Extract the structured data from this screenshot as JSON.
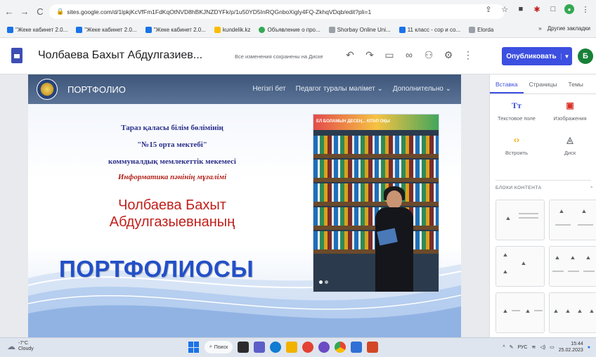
{
  "browser": {
    "url": "sites.google.com/d/1lpkjKcVfFm1FdKqOtNVD8hBKJNZDYFk/p/1u50YD5InRQGnboXigly4FQ-ZkhqVDqb/edit?pli=1",
    "bookmarks": [
      "\"Жеке кабинет 2.0...",
      "\"Жеке кабинет 2.0...",
      "\"Жеке кабинет 2.0...",
      "kundelik.kz",
      "Объявление о про...",
      "Shorbay Online Uni...",
      "11 класс - сор и со...",
      "Elorda"
    ],
    "other_bookmarks": "Другие закладки"
  },
  "editor": {
    "doc_title": "Чолбаева Бахыт Абдулгазиев...",
    "save_status": "Все изменения сохранены на Диске",
    "publish_label": "Опубликовать",
    "avatar_letter": "Б"
  },
  "site": {
    "name": "ПОРТФОЛИО",
    "menu": [
      "Негізгі бет",
      "Педагог туралы мәлімет",
      "Дополнительно"
    ],
    "school_line1": "Тараз қаласы білім бөлімінің",
    "school_line2": "\"№15 орта мектебі\"",
    "school_line3": "коммуналдық мемлекеттік мекемесі",
    "school_line4": "Информатика пәнінің мұғалімі",
    "teacher_line1": "Чолбаева Бахыт",
    "teacher_line2": "Абдулгазыевнаның",
    "portfolio_big": "ПОРТФОЛИОСЫ",
    "photo_banner": "ЕЛ БОЛАМЫН ДЕСЕҢ... КІТАП ОҚЫ"
  },
  "panel": {
    "tabs": [
      "Вставка",
      "Страницы",
      "Темы"
    ],
    "insert_items": [
      {
        "label": "Текстовое поле",
        "glyph": "Tт"
      },
      {
        "label": "Изображения",
        "glyph": "▣"
      },
      {
        "label": "Встроить",
        "glyph": "‹›"
      },
      {
        "label": "Диск",
        "glyph": "◬"
      }
    ],
    "blocks_header": "БЛОКИ КОНТЕНТА"
  },
  "taskbar": {
    "weather_temp": "-7°C",
    "weather_desc": "Cloudy",
    "search_label": "Поиск",
    "lang": "РУС",
    "time": "15:44",
    "date": "25.02.2023"
  }
}
